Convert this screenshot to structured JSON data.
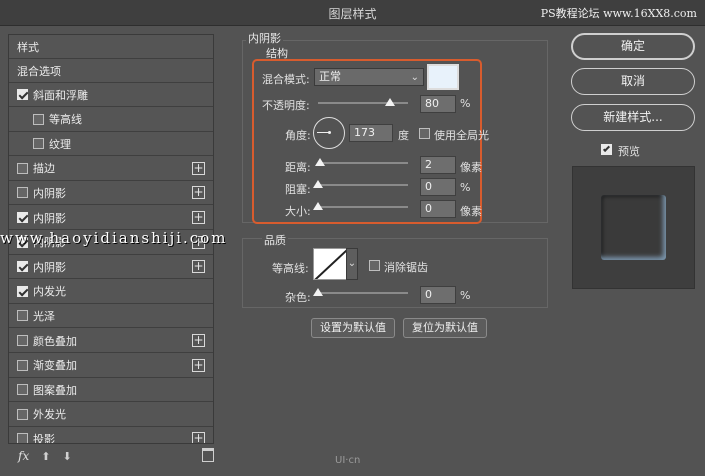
{
  "window": {
    "title": "图层样式",
    "watermark_top": "PS教程论坛 www.16XX8.com"
  },
  "left": {
    "header": "样式",
    "blend_options": "混合选项",
    "items": [
      {
        "label": "斜面和浮雕",
        "checked": true,
        "plus": false,
        "sub": false
      },
      {
        "label": "等高线",
        "checked": false,
        "plus": false,
        "sub": true
      },
      {
        "label": "纹理",
        "checked": false,
        "plus": false,
        "sub": true
      },
      {
        "label": "描边",
        "checked": false,
        "plus": true,
        "sub": false
      },
      {
        "label": "内阴影",
        "checked": false,
        "plus": true,
        "sub": false
      },
      {
        "label": "内阴影",
        "checked": true,
        "plus": true,
        "sub": false
      },
      {
        "label": "内阴影",
        "checked": true,
        "plus": true,
        "sub": false
      },
      {
        "label": "内阴影",
        "checked": true,
        "plus": true,
        "sub": false
      },
      {
        "label": "内发光",
        "checked": true,
        "plus": false,
        "sub": false
      },
      {
        "label": "光泽",
        "checked": false,
        "plus": false,
        "sub": false
      },
      {
        "label": "颜色叠加",
        "checked": false,
        "plus": true,
        "sub": false
      },
      {
        "label": "渐变叠加",
        "checked": false,
        "plus": true,
        "sub": false
      },
      {
        "label": "图案叠加",
        "checked": false,
        "plus": false,
        "sub": false
      },
      {
        "label": "外发光",
        "checked": false,
        "plus": false,
        "sub": false
      },
      {
        "label": "投影",
        "checked": false,
        "plus": true,
        "sub": false
      }
    ],
    "toolbar": {
      "fx": "fx",
      "up": "⬆",
      "down": "⬇"
    }
  },
  "panel": {
    "section_title": "内阴影",
    "structure_title": "结构",
    "blend_mode_label": "混合模式:",
    "blend_mode_value": "正常",
    "opacity_label": "不透明度:",
    "opacity_value": "80",
    "opacity_unit": "%",
    "opacity_fraction": 0.8,
    "angle_label": "角度:",
    "angle_value": "173",
    "angle_unit": "度",
    "global_light_label": "使用全局光",
    "distance_label": "距离:",
    "distance_value": "2",
    "distance_unit": "像素",
    "choke_label": "阻塞:",
    "choke_value": "0",
    "choke_unit": "%",
    "size_label": "大小:",
    "size_value": "0",
    "size_unit": "像素",
    "quality_title": "品质",
    "contour_label": "等高线:",
    "antialias_label": "消除锯齿",
    "noise_label": "杂色:",
    "noise_value": "0",
    "noise_unit": "%",
    "set_default": "设置为默认值",
    "reset_default": "复位为默认值",
    "shadow_color": "#e8f2fb"
  },
  "right": {
    "ok": "确定",
    "cancel": "取消",
    "new_style": "新建样式...",
    "preview_label": "预览"
  },
  "watermark_overlay": "www.haoyidianshiji.com",
  "bottom_logo": "UI·cn"
}
